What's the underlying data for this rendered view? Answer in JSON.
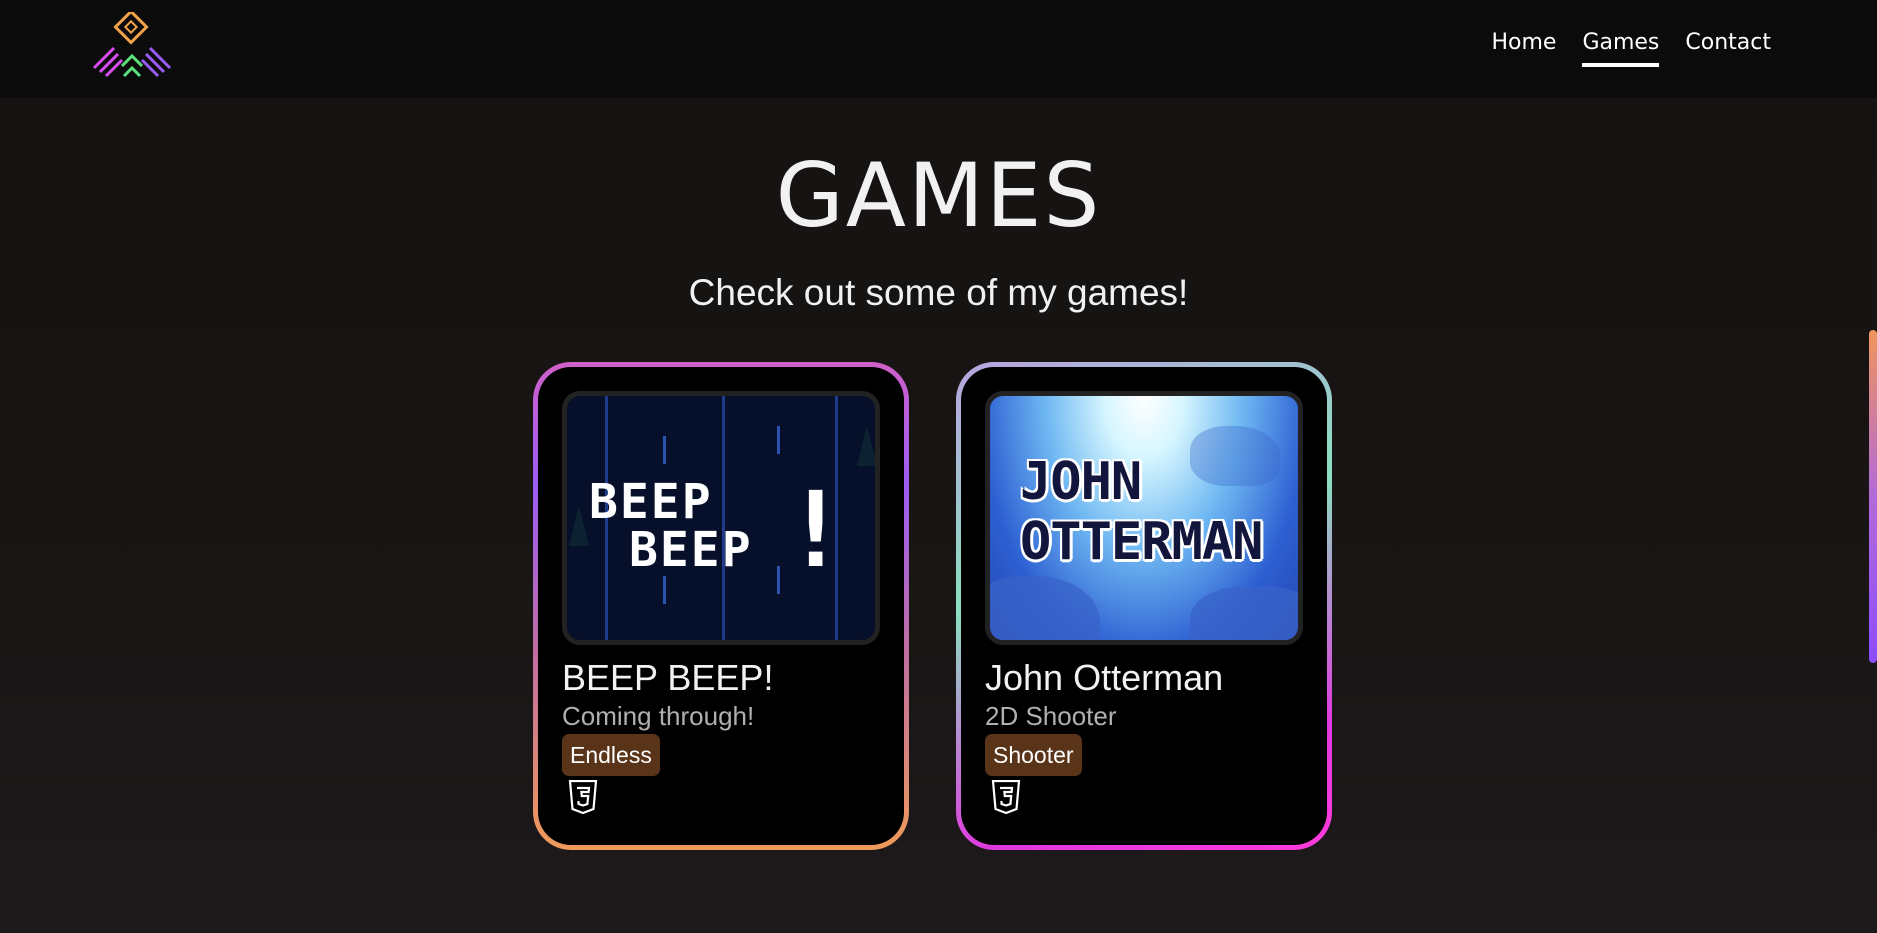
{
  "nav": {
    "items": [
      {
        "label": "Home",
        "active": false
      },
      {
        "label": "Games",
        "active": true
      },
      {
        "label": "Contact",
        "active": false
      }
    ]
  },
  "hero": {
    "title": "GAMES",
    "subtitle": "Check out some of my games!"
  },
  "games": [
    {
      "title": "BEEP BEEP!",
      "subtitle": "Coming through!",
      "tag": "Endless",
      "platform_icon": "html5-icon",
      "thumb_text_line1": "BEEP",
      "thumb_text_line2": "BEEP",
      "thumb_text_bang": "!"
    },
    {
      "title": "John Otterman",
      "subtitle": "2D Shooter",
      "tag": "Shooter",
      "platform_icon": "html5-icon",
      "thumb_text_line1": "JOHN",
      "thumb_text_line2": "OTTERMAN"
    }
  ],
  "colors": {
    "tag_bg": "#5a3418",
    "card_bg": "#000000",
    "page_bg": "#161312"
  }
}
